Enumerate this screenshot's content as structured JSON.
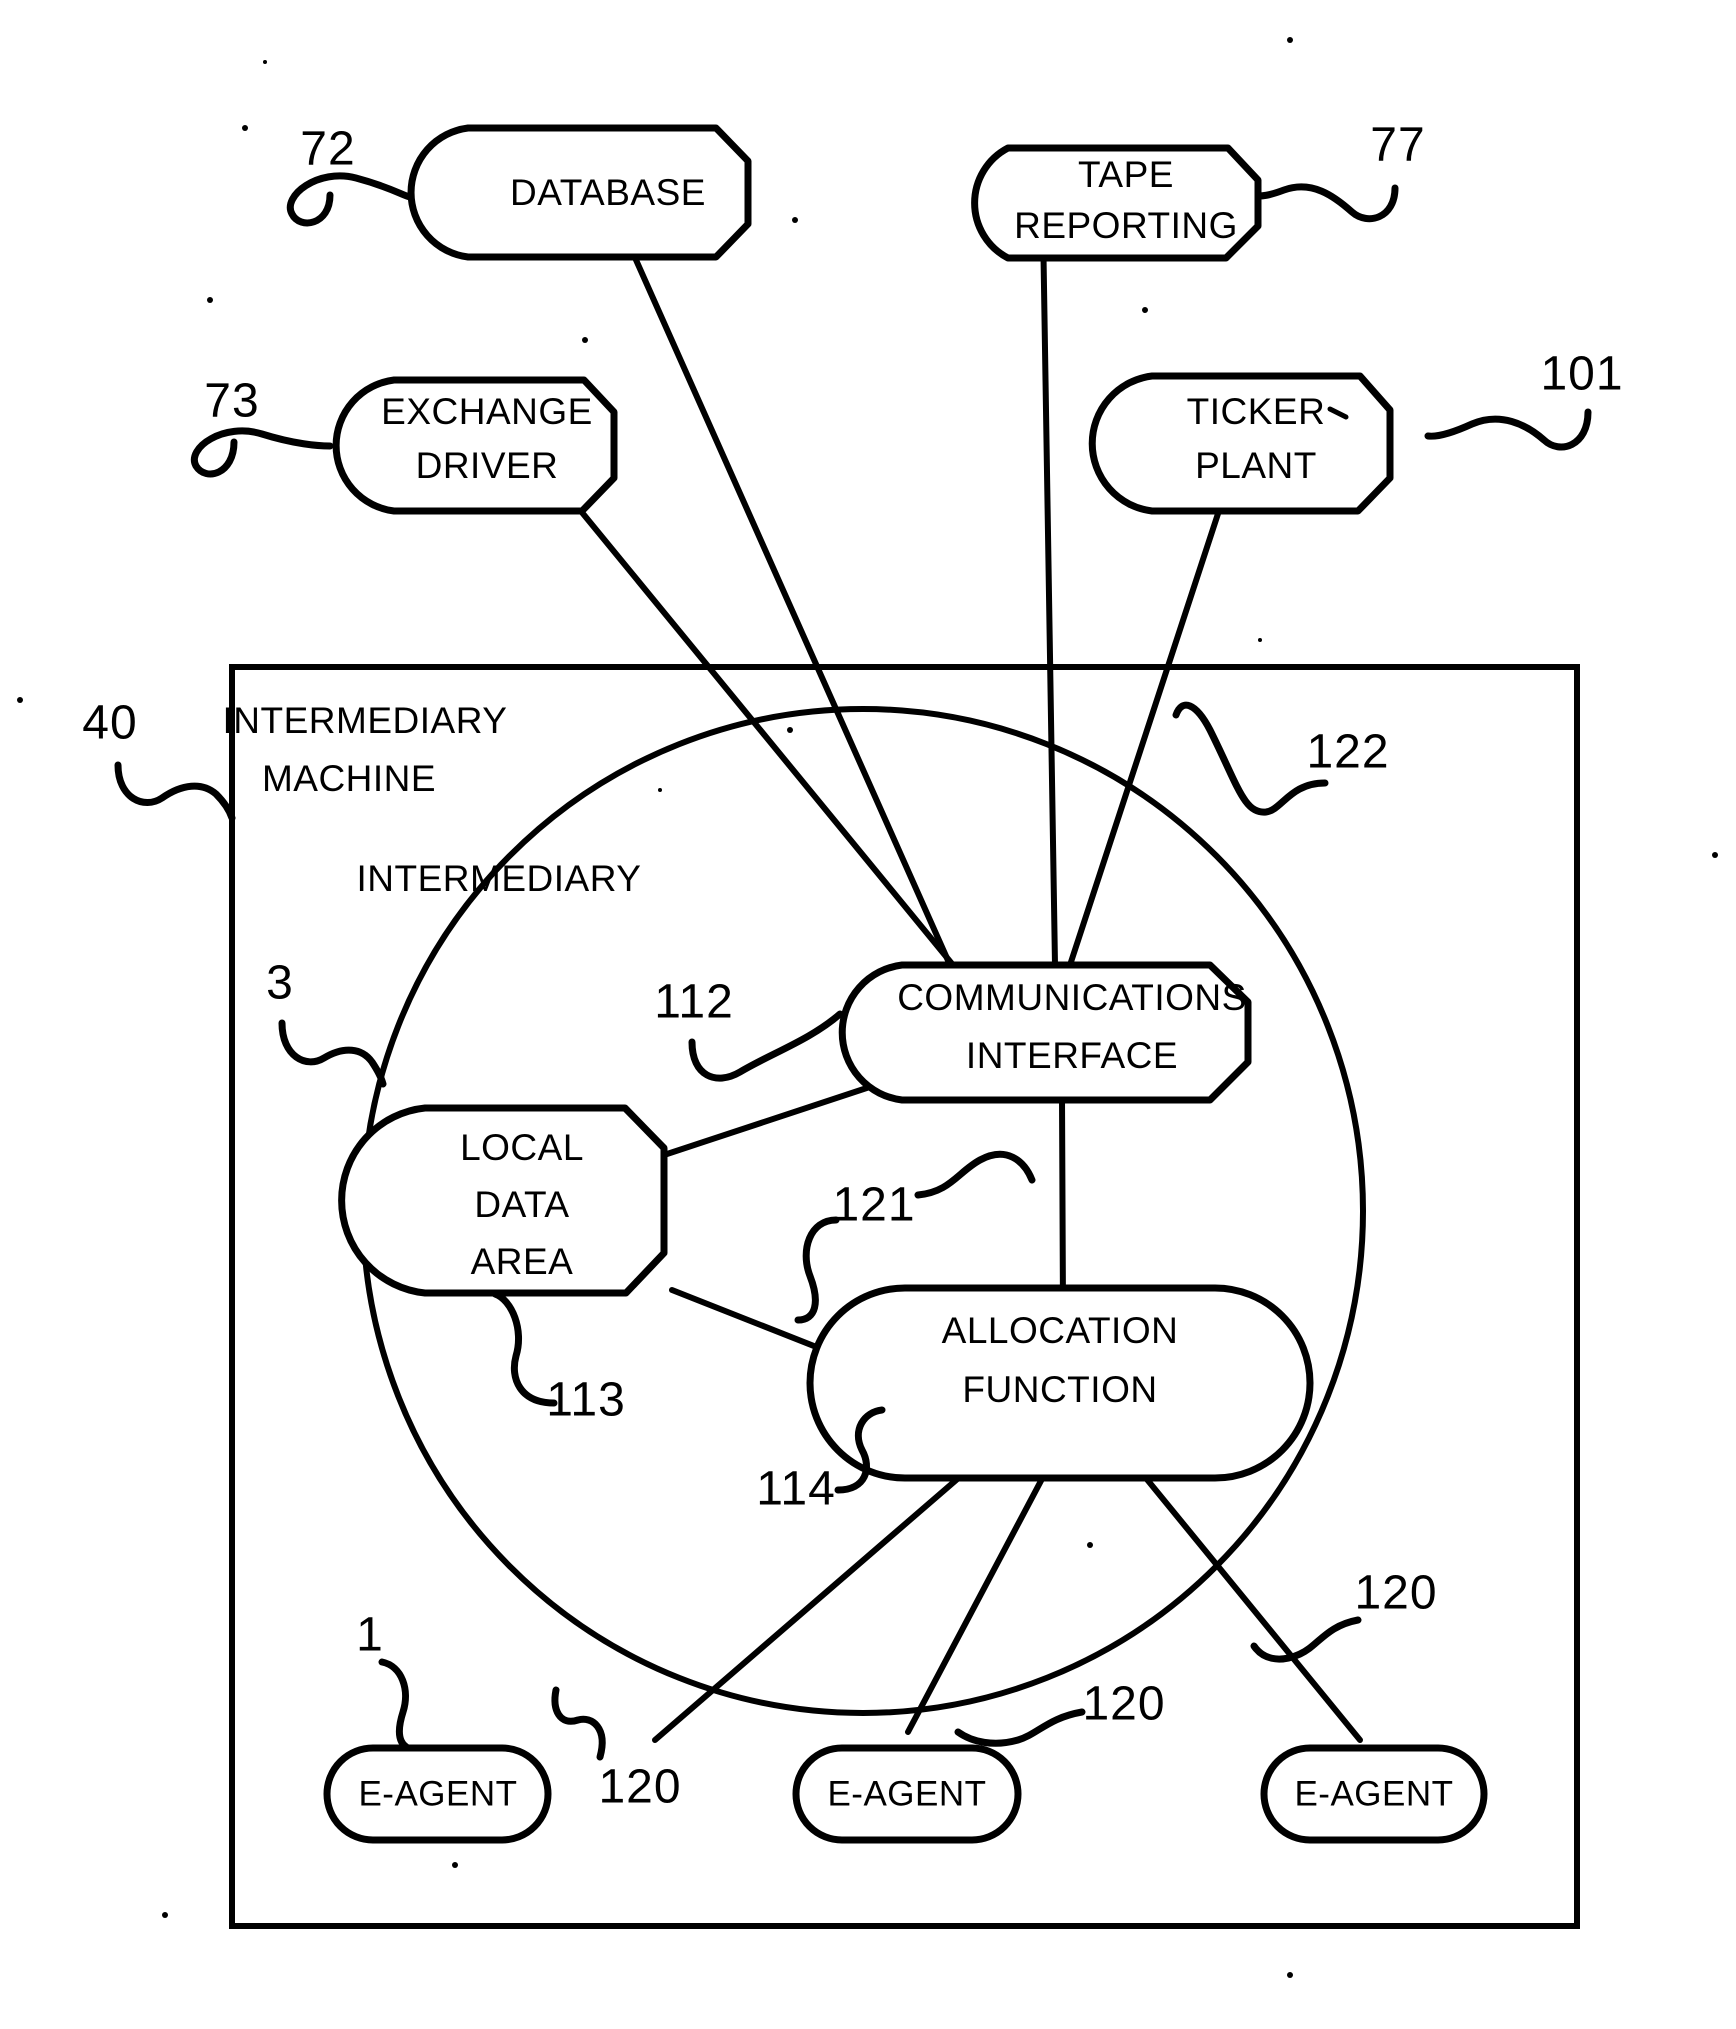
{
  "figure": {
    "title": "Intermediary machine block diagram",
    "background_color": "#ffffff",
    "line_color": "#000000"
  },
  "external_nodes": [
    {
      "id": "database",
      "label": "DATABASE",
      "ref": "72",
      "shape": "flag-rounded"
    },
    {
      "id": "tape_reporting",
      "label_line1": "TAPE",
      "label_line2": "REPORTING",
      "ref": "77",
      "shape": "flag-rounded"
    },
    {
      "id": "exchange_driver",
      "label_line1": "EXCHANGE",
      "label_line2": "DRIVER",
      "ref": "73",
      "shape": "flag-rounded"
    },
    {
      "id": "ticker_plant",
      "label_line1": "TICKER",
      "label_line2": "PLANT",
      "ref": "101",
      "shape": "flag-rounded"
    }
  ],
  "container": {
    "label_line1": "INTERMEDIARY",
    "label_line2": "MACHINE",
    "ref": "40"
  },
  "circle_region": {
    "label": "INTERMEDIARY",
    "ref": "3"
  },
  "internal_nodes": [
    {
      "id": "communications_interface",
      "label_line1": "COMMUNICATIONS",
      "label_line2": "INTERFACE",
      "ref": "112"
    },
    {
      "id": "local_data_area",
      "label_line1": "LOCAL",
      "label_line2": "DATA",
      "label_line3": "AREA",
      "ref": "113"
    },
    {
      "id": "allocation_function",
      "label_line1": "ALLOCATION",
      "label_line2": "FUNCTION",
      "ref": "114"
    }
  ],
  "agents": [
    {
      "id": "agent_left",
      "label": "E-AGENT",
      "ref": "1"
    },
    {
      "id": "agent_middle",
      "label": "E-AGENT"
    },
    {
      "id": "agent_right",
      "label": "E-AGENT"
    }
  ],
  "link_refs": {
    "external_bus": "122",
    "internal_link": "121",
    "agent_link_1": "120",
    "agent_link_2": "120",
    "agent_link_3": "120"
  },
  "all_reference_numerals": [
    "72",
    "77",
    "73",
    "101",
    "40",
    "3",
    "112",
    "122",
    "121",
    "113",
    "114",
    "1",
    "120",
    "120",
    "120"
  ]
}
